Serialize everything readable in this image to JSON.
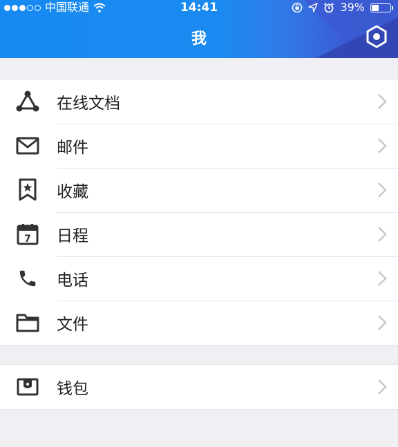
{
  "status_bar": {
    "carrier": "中国联通",
    "time": "14:41",
    "battery": "39%",
    "battery_level": 0.39
  },
  "header": {
    "title": "我",
    "settings_icon": "hexagon-settings-icon"
  },
  "menu_group_1": [
    {
      "label": "在线文档",
      "icon": "triangle-nodes-icon"
    },
    {
      "label": "邮件",
      "icon": "envelope-icon"
    },
    {
      "label": "收藏",
      "icon": "bookmark-star-icon"
    },
    {
      "label": "日程",
      "icon": "calendar-icon"
    },
    {
      "label": "电话",
      "icon": "phone-icon"
    },
    {
      "label": "文件",
      "icon": "folder-icon"
    }
  ],
  "menu_group_2": [
    {
      "label": "钱包",
      "icon": "wallet-icon"
    }
  ],
  "calendar_icon_day": "7",
  "colors": {
    "header_blue": "#1689f2",
    "header_dark": "#3343b8",
    "background": "#efeff4",
    "icon": "#333333",
    "chevron": "#c7c7cc"
  }
}
